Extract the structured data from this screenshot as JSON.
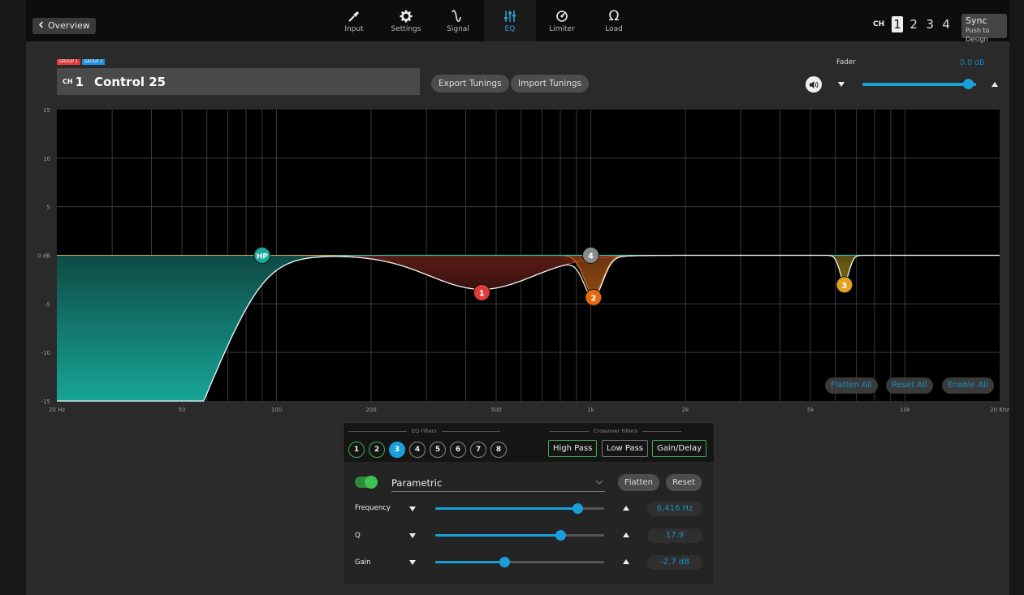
{
  "topbar": {
    "back_label": "Overview",
    "nav": [
      {
        "label": "Input",
        "icon": "input-jack-icon",
        "active": false
      },
      {
        "label": "Settings",
        "icon": "gear-icon",
        "active": false
      },
      {
        "label": "Signal",
        "icon": "signal-wave-icon",
        "active": false
      },
      {
        "label": "EQ",
        "icon": "eq-sliders-icon",
        "active": true
      },
      {
        "label": "Limiter",
        "icon": "limiter-gauge-icon",
        "active": false
      },
      {
        "label": "Load",
        "icon": "ohm-icon",
        "active": false
      }
    ],
    "channel_label": "CH",
    "channels": [
      "1",
      "2",
      "3",
      "4"
    ],
    "active_channel": "1",
    "sync_title": "Sync",
    "sync_subtitle": "Push to Design"
  },
  "header": {
    "group_tags": [
      "GROUP 1",
      "GROUP 2"
    ],
    "ch_prefix": "CH",
    "ch_number": "1",
    "channel_name": "Control 25",
    "export_label": "Export Tunings",
    "import_label": "Import Tunings",
    "fader_label": "Fader",
    "fader_value": "0.0 dB",
    "fader_level": 0.93
  },
  "graph": {
    "y_ticks": [
      "15",
      "10",
      "5",
      "0 dB",
      "-5",
      "-10",
      "-15"
    ],
    "x_ticks": [
      "20 Hz",
      "50",
      "100",
      "200",
      "500",
      "1k",
      "2k",
      "5k",
      "10k",
      "20 Khz"
    ],
    "markers": [
      {
        "label": "HP",
        "freq": 90,
        "gain": 0,
        "color": "#19a99c"
      },
      {
        "label": "1",
        "freq": 450,
        "gain": -3.5,
        "color": "#e23b3b"
      },
      {
        "label": "2",
        "freq": 1020,
        "gain": -4,
        "color": "#e86a10"
      },
      {
        "label": "4",
        "freq": 1000,
        "gain": 0,
        "color": "#8a8a8a"
      },
      {
        "label": "3",
        "freq": 6416,
        "gain": -2.7,
        "color": "#e2a21f"
      }
    ],
    "buttons": {
      "flatten_all": "Flatten All",
      "reset_all": "Reset All",
      "enable_all": "Enable All"
    }
  },
  "panel": {
    "eq_filters_label": "EQ Filters",
    "crossover_label": "Crossover Filters",
    "filters": [
      {
        "label": "1",
        "state": "enabled"
      },
      {
        "label": "2",
        "state": "enabled"
      },
      {
        "label": "3",
        "state": "selected"
      },
      {
        "label": "4",
        "state": "off"
      },
      {
        "label": "5",
        "state": "off"
      },
      {
        "label": "6",
        "state": "off"
      },
      {
        "label": "7",
        "state": "off"
      },
      {
        "label": "8",
        "state": "off"
      }
    ],
    "crossover": [
      {
        "label": "High Pass",
        "on": true
      },
      {
        "label": "Low Pass",
        "on": false
      },
      {
        "label": "Gain/Delay",
        "on": true
      }
    ],
    "filter_type": "Parametric",
    "flatten_label": "Flatten",
    "reset_label": "Reset",
    "rows": [
      {
        "label": "Frequency",
        "value": "6,416 Hz",
        "level": 0.84
      },
      {
        "label": "Q",
        "value": "17.9",
        "level": 0.74
      },
      {
        "label": "Gain",
        "value": "-2.7 dB",
        "level": 0.41
      }
    ]
  }
}
